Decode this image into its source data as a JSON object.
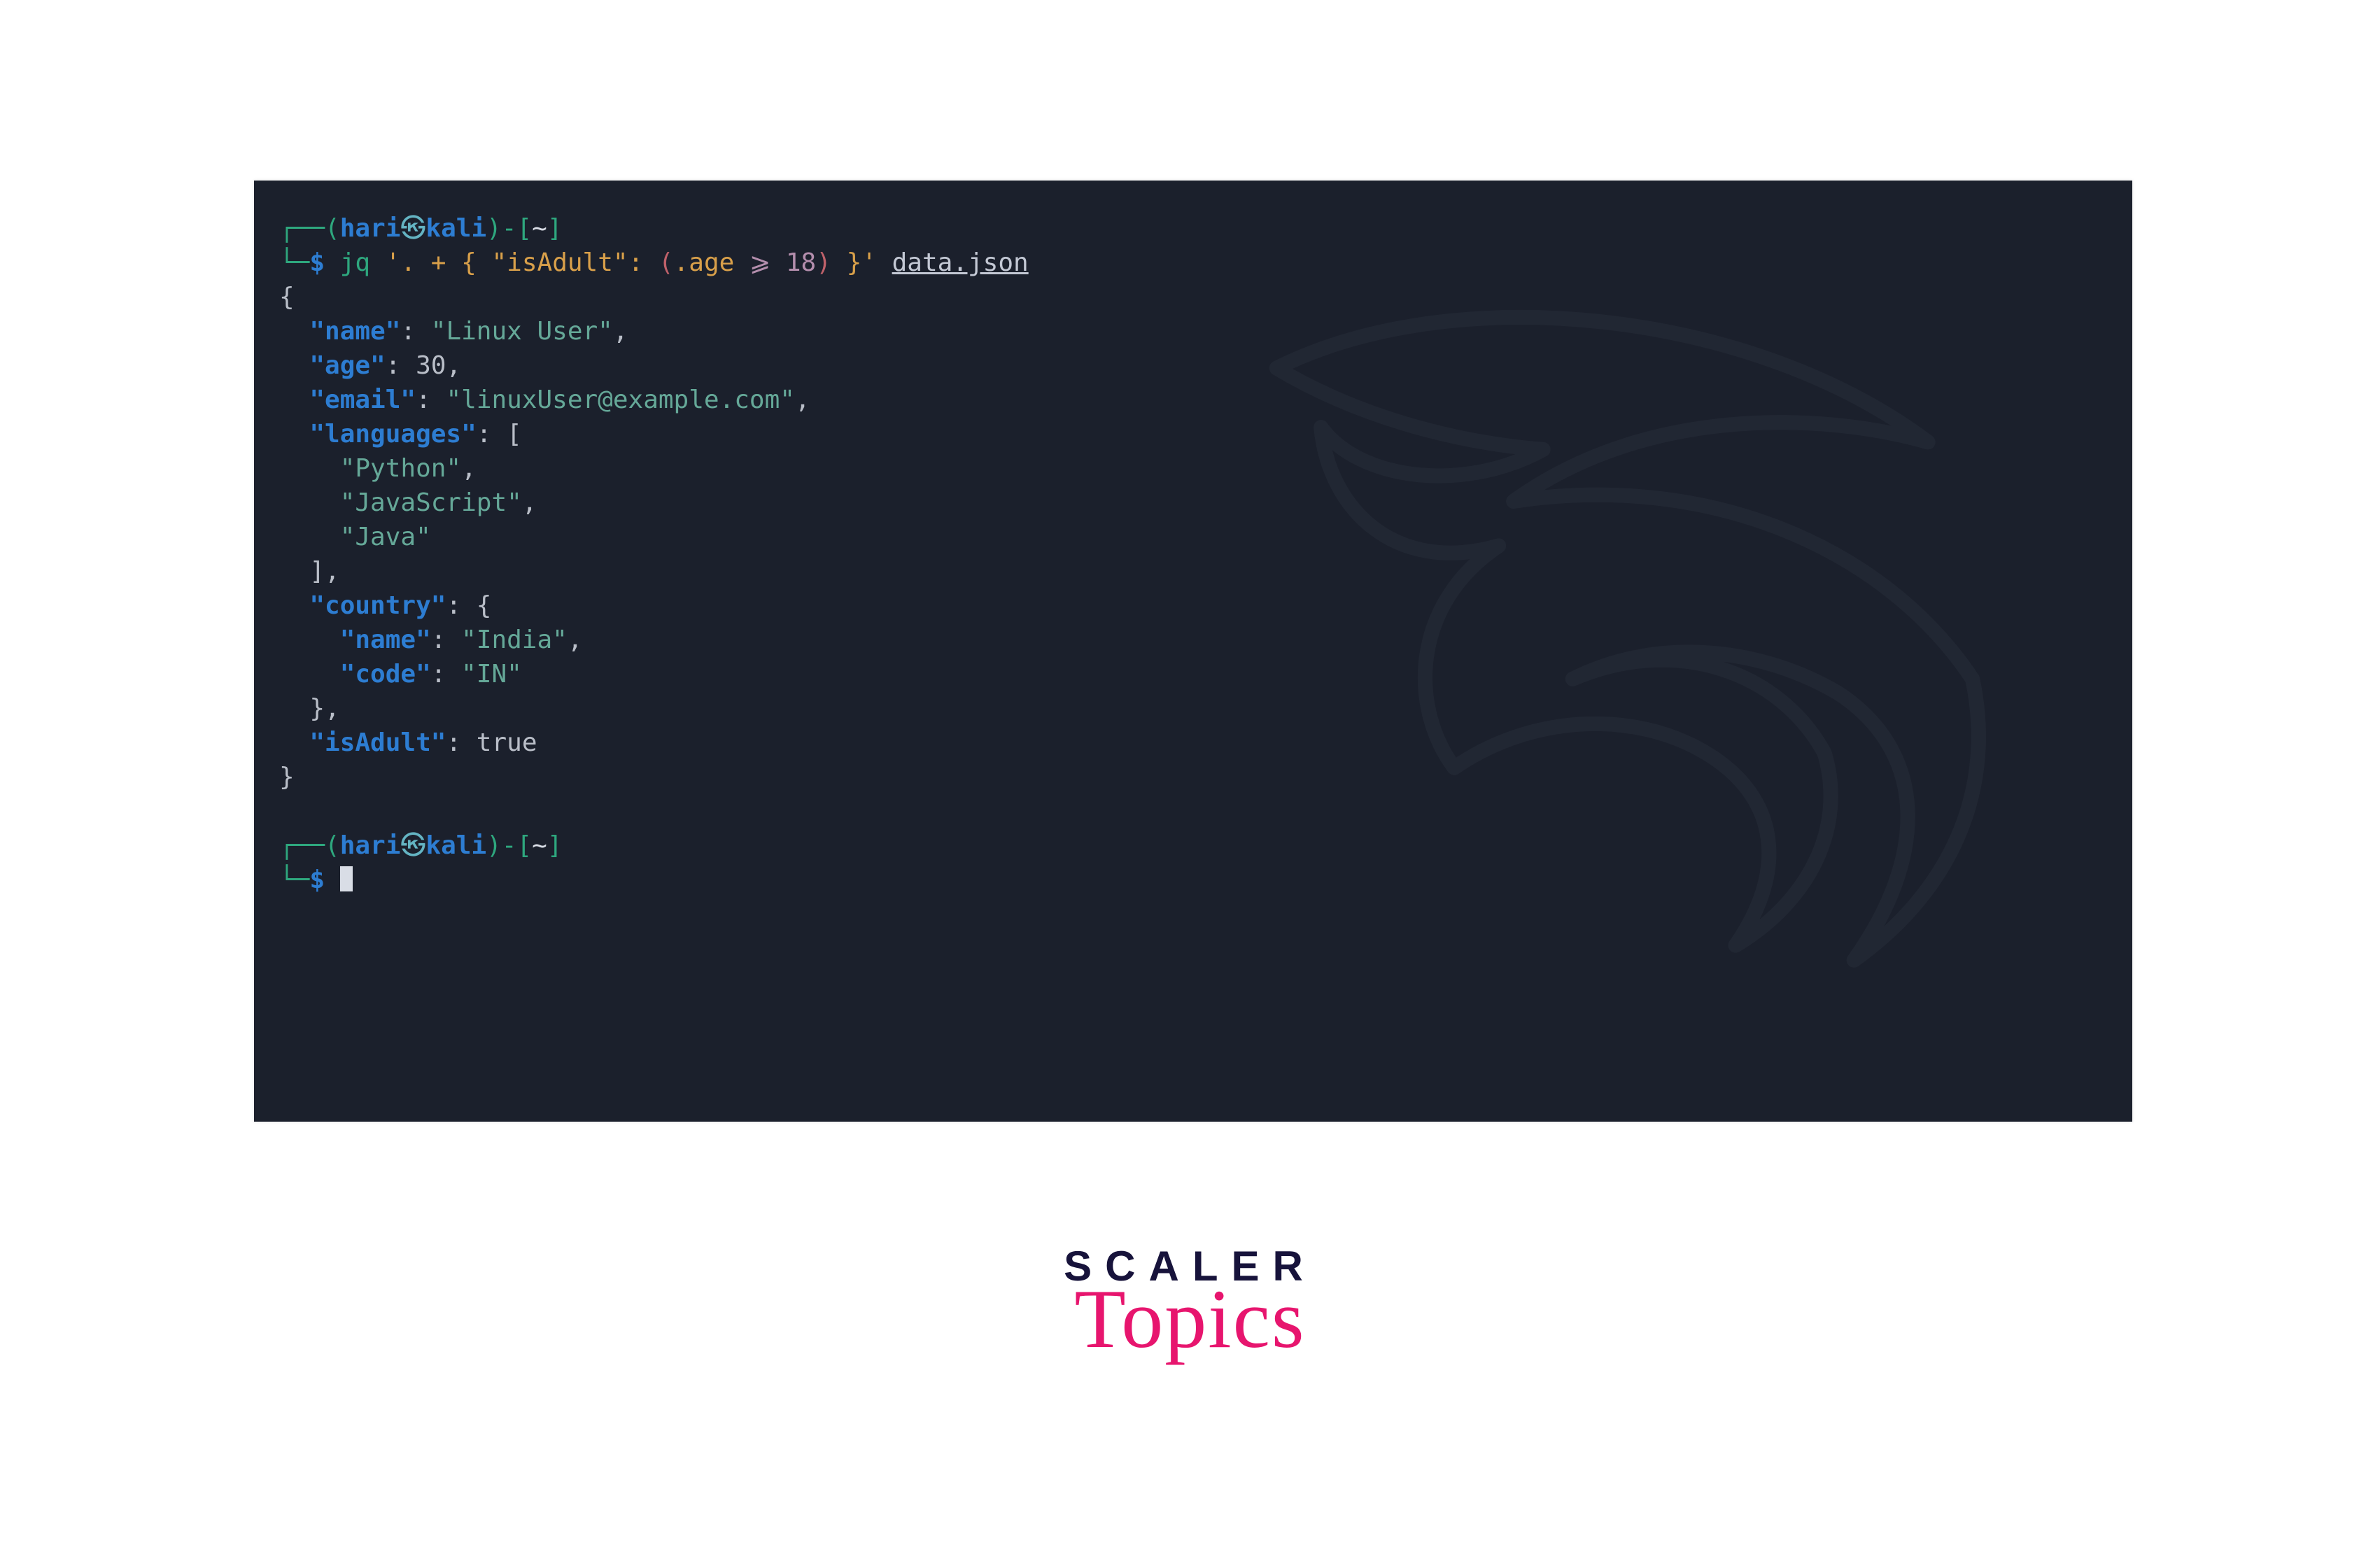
{
  "prompt": {
    "user": "hari",
    "at": "㉿",
    "host": "kali",
    "path": "~",
    "symbol": "$"
  },
  "command": {
    "bin": "jq",
    "arg_open": "'. + { ",
    "key_isAdult": "\"isAdult\"",
    "colon": ": ",
    "paren_open": "(",
    "age_ref": ".age ",
    "op": "⩾",
    "num": " 18",
    "paren_close": ")",
    "arg_close": " }'",
    "space": " ",
    "file": "data.json"
  },
  "output": {
    "l0": "{",
    "name_k": "\"name\"",
    "name_v": "\"Linux User\"",
    "age_k": "\"age\"",
    "age_v": "30",
    "email_k": "\"email\"",
    "email_v": "\"linuxUser@example.com\"",
    "langs_k": "\"languages\"",
    "lang0": "\"Python\"",
    "lang1": "\"JavaScript\"",
    "lang2": "\"Java\"",
    "country_k": "\"country\"",
    "cname_k": "\"name\"",
    "cname_v": "\"India\"",
    "ccode_k": "\"code\"",
    "ccode_v": "\"IN\"",
    "isAdult_k": "\"isAdult\"",
    "isAdult_v": "true",
    "lbrack": "[",
    "rbrack_comma": "],",
    "lbrace": "{",
    "rbrace_comma": "},",
    "rbrace": "}",
    "colon_sp": ": ",
    "comma": ","
  },
  "logo": {
    "line1": "SCALER",
    "line2": "Topics"
  }
}
